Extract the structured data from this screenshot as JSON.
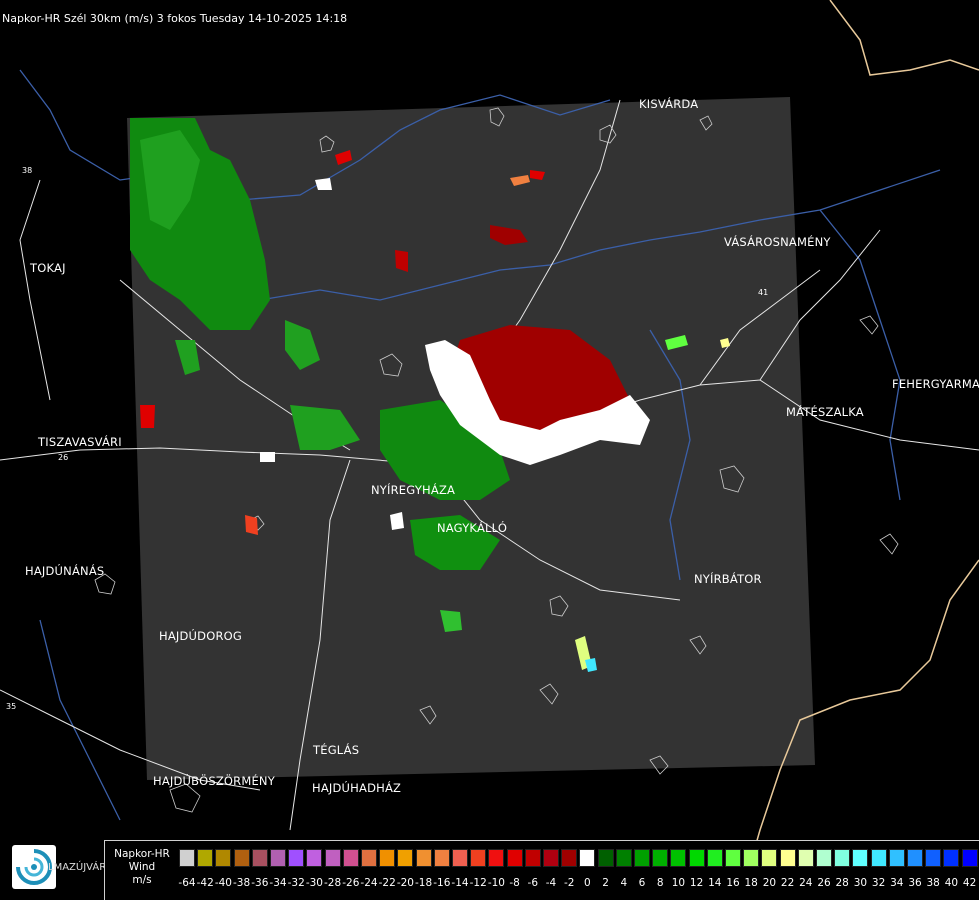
{
  "header": {
    "title": "Napkor-HR Szél 30km (m/s) 3 fokos Tuesday 14-10-2025 14:18"
  },
  "cities": [
    {
      "id": "kisvarda",
      "label": "KISVÁRDA"
    },
    {
      "id": "tokaj",
      "label": "TOKAJ"
    },
    {
      "id": "vasarosnameny",
      "label": "VÁSÁROSNAMÉNY"
    },
    {
      "id": "fehergyarmat",
      "label": "FEHERGYARMA"
    },
    {
      "id": "mateszalka",
      "label": "MÁTÉSZALKA"
    },
    {
      "id": "tiszavasvari",
      "label": "TISZAVASVÁRI"
    },
    {
      "id": "nyiregyhaza",
      "label": "NYÍREGYHÁZA"
    },
    {
      "id": "nagykallo",
      "label": "NAGYKÁLLÓ"
    },
    {
      "id": "nyirbator",
      "label": "NYÍRBÁTOR"
    },
    {
      "id": "hajdunanas",
      "label": "HAJDÚNÁNÁS"
    },
    {
      "id": "hajdudorog",
      "label": "HAJDÚDOROG"
    },
    {
      "id": "teglas",
      "label": "TÉGLÁS"
    },
    {
      "id": "hajduboszormeny",
      "label": "HAJDÚBÖSZÖRMÉNY"
    },
    {
      "id": "hajduhadhaz",
      "label": "HAJDÚHADHÁZ"
    }
  ],
  "road_numbers": [
    "38",
    "26",
    "41",
    "35"
  ],
  "legend": {
    "line1": "Napkor-HR",
    "line2": "Wind",
    "line3": "m/s",
    "ticks": [
      "-64",
      "-42",
      "-40",
      "-38",
      "-36",
      "-34",
      "-32",
      "-30",
      "-28",
      "-26",
      "-24",
      "-22",
      "-20",
      "-18",
      "-16",
      "-14",
      "-12",
      "-10",
      "-8",
      "-6",
      "-4",
      "-2",
      "0",
      "2",
      "4",
      "6",
      "8",
      "10",
      "12",
      "14",
      "16",
      "18",
      "20",
      "22",
      "24",
      "26",
      "28",
      "30",
      "32",
      "34",
      "36",
      "38",
      "40",
      "42"
    ],
    "colors": [
      "#d0d0d0",
      "#b0a800",
      "#b08800",
      "#b06010",
      "#a85060",
      "#b060b0",
      "#a050ff",
      "#c060e0",
      "#c060c0",
      "#d05090",
      "#e07040",
      "#f09000",
      "#f0a000",
      "#f09030",
      "#f08040",
      "#f06050",
      "#f04020",
      "#f01010",
      "#e00000",
      "#c00000",
      "#b00010",
      "#a00000",
      "#ffffff",
      "#006000",
      "#008000",
      "#00a000",
      "#00b000",
      "#00c000",
      "#00d800",
      "#20ee20",
      "#60ff40",
      "#a0ff60",
      "#e0ff80",
      "#ffff90",
      "#e0ffb0",
      "#b0ffd0",
      "#80ffe0",
      "#60ffff",
      "#40e8ff",
      "#30c0ff",
      "#2090ff",
      "#1060ff",
      "#0030ff",
      "#0000ff"
    ]
  },
  "logo": {
    "text": "LMAZÚJVÁR"
  }
}
